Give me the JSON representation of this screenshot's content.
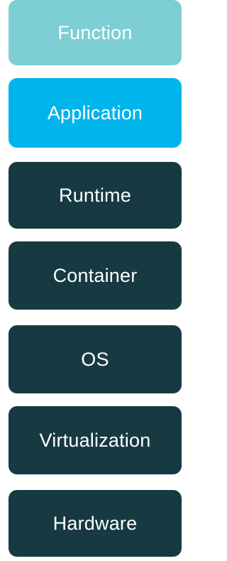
{
  "layers": [
    {
      "key": "function",
      "label": "Function",
      "color": "#7dcfd4"
    },
    {
      "key": "application",
      "label": "Application",
      "color": "#00b4ec"
    },
    {
      "key": "runtime",
      "label": "Runtime",
      "color": "#173a42"
    },
    {
      "key": "container",
      "label": "Container",
      "color": "#173a42"
    },
    {
      "key": "os",
      "label": "OS",
      "color": "#173a42"
    },
    {
      "key": "virtualization",
      "label": "Virtualization",
      "color": "#173a42"
    },
    {
      "key": "hardware",
      "label": "Hardware",
      "color": "#173a42"
    }
  ]
}
